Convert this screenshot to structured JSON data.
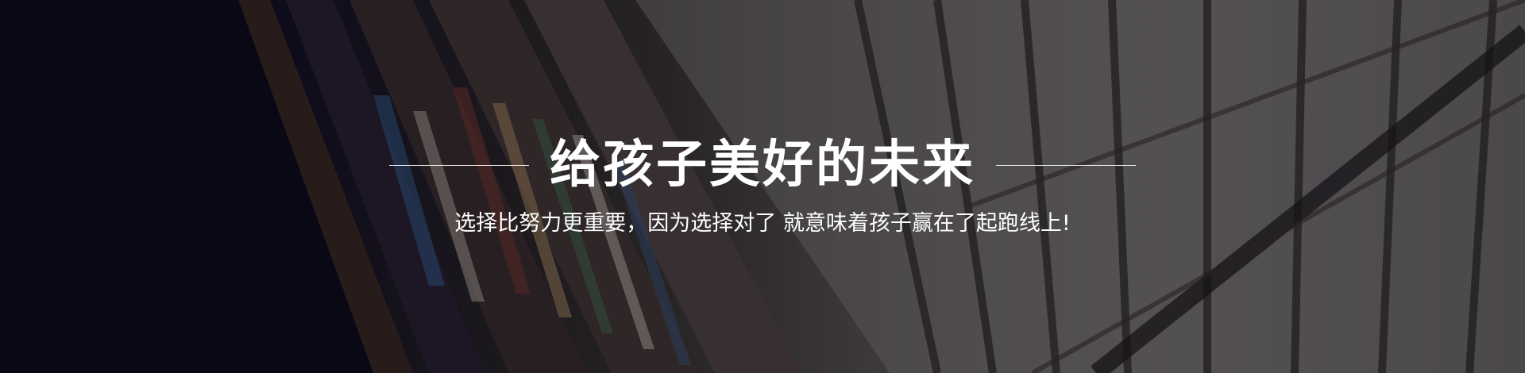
{
  "banner": {
    "headline": "给孩子美好的未来",
    "subtitle": "选择比努力更重要，因为选择对了 就意味着孩子赢在了起跑线上!"
  },
  "colors": {
    "text": "#ffffff",
    "overlay": "#08061a"
  }
}
